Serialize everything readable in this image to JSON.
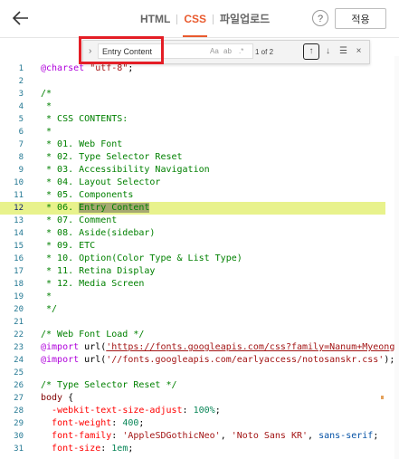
{
  "header": {
    "back_icon": "arrow-left-icon",
    "tabs": [
      "HTML",
      "CSS",
      "파일업로드"
    ],
    "help_label": "?",
    "apply_label": "적용"
  },
  "find": {
    "query": "Entry Content",
    "case_label": "Aa",
    "word_label": "ab",
    "regex_label": ".*",
    "count": "1 of 2"
  },
  "code_lines": [
    {
      "n": "1",
      "t": "@charset \"utf-8\";"
    },
    {
      "n": "2",
      "t": ""
    },
    {
      "n": "3",
      "t": "/*"
    },
    {
      "n": "4",
      "t": " *"
    },
    {
      "n": "5",
      "t": " * CSS CONTENTS:"
    },
    {
      "n": "6",
      "t": " *"
    },
    {
      "n": "7",
      "t": " * 01. Web Font"
    },
    {
      "n": "8",
      "t": " * 02. Type Selector Reset"
    },
    {
      "n": "9",
      "t": " * 03. Accessibility Navigation"
    },
    {
      "n": "10",
      "t": " * 04. Layout Selector"
    },
    {
      "n": "11",
      "t": " * 05. Components"
    },
    {
      "n": "12",
      "t": " * 06. Entry Content"
    },
    {
      "n": "13",
      "t": " * 07. Comment"
    },
    {
      "n": "14",
      "t": " * 08. Aside(sidebar)"
    },
    {
      "n": "15",
      "t": " * 09. ETC"
    },
    {
      "n": "16",
      "t": " * 10. Option(Color Type & List Type)"
    },
    {
      "n": "17",
      "t": " * 11. Retina Display"
    },
    {
      "n": "18",
      "t": " * 12. Media Screen"
    },
    {
      "n": "19",
      "t": " *"
    },
    {
      "n": "20",
      "t": " */"
    },
    {
      "n": "21",
      "t": ""
    },
    {
      "n": "22",
      "t": "/* Web Font Load */"
    },
    {
      "n": "23",
      "t": "@import url('https://fonts.googleapis.com/css?family=Nanum+Myeongjo"
    },
    {
      "n": "24",
      "t": "@import url('//fonts.googleapis.com/earlyaccess/notosanskr.css');"
    },
    {
      "n": "25",
      "t": ""
    },
    {
      "n": "26",
      "t": "/* Type Selector Reset */"
    },
    {
      "n": "27",
      "t": "body {"
    },
    {
      "n": "28",
      "t": "  -webkit-text-size-adjust: 100%;"
    },
    {
      "n": "29",
      "t": "  font-weight: 400;"
    },
    {
      "n": "30",
      "t": "  font-family: 'AppleSDGothicNeo', 'Noto Sans KR', sans-serif;"
    },
    {
      "n": "31",
      "t": "  font-size: 1em;"
    }
  ]
}
